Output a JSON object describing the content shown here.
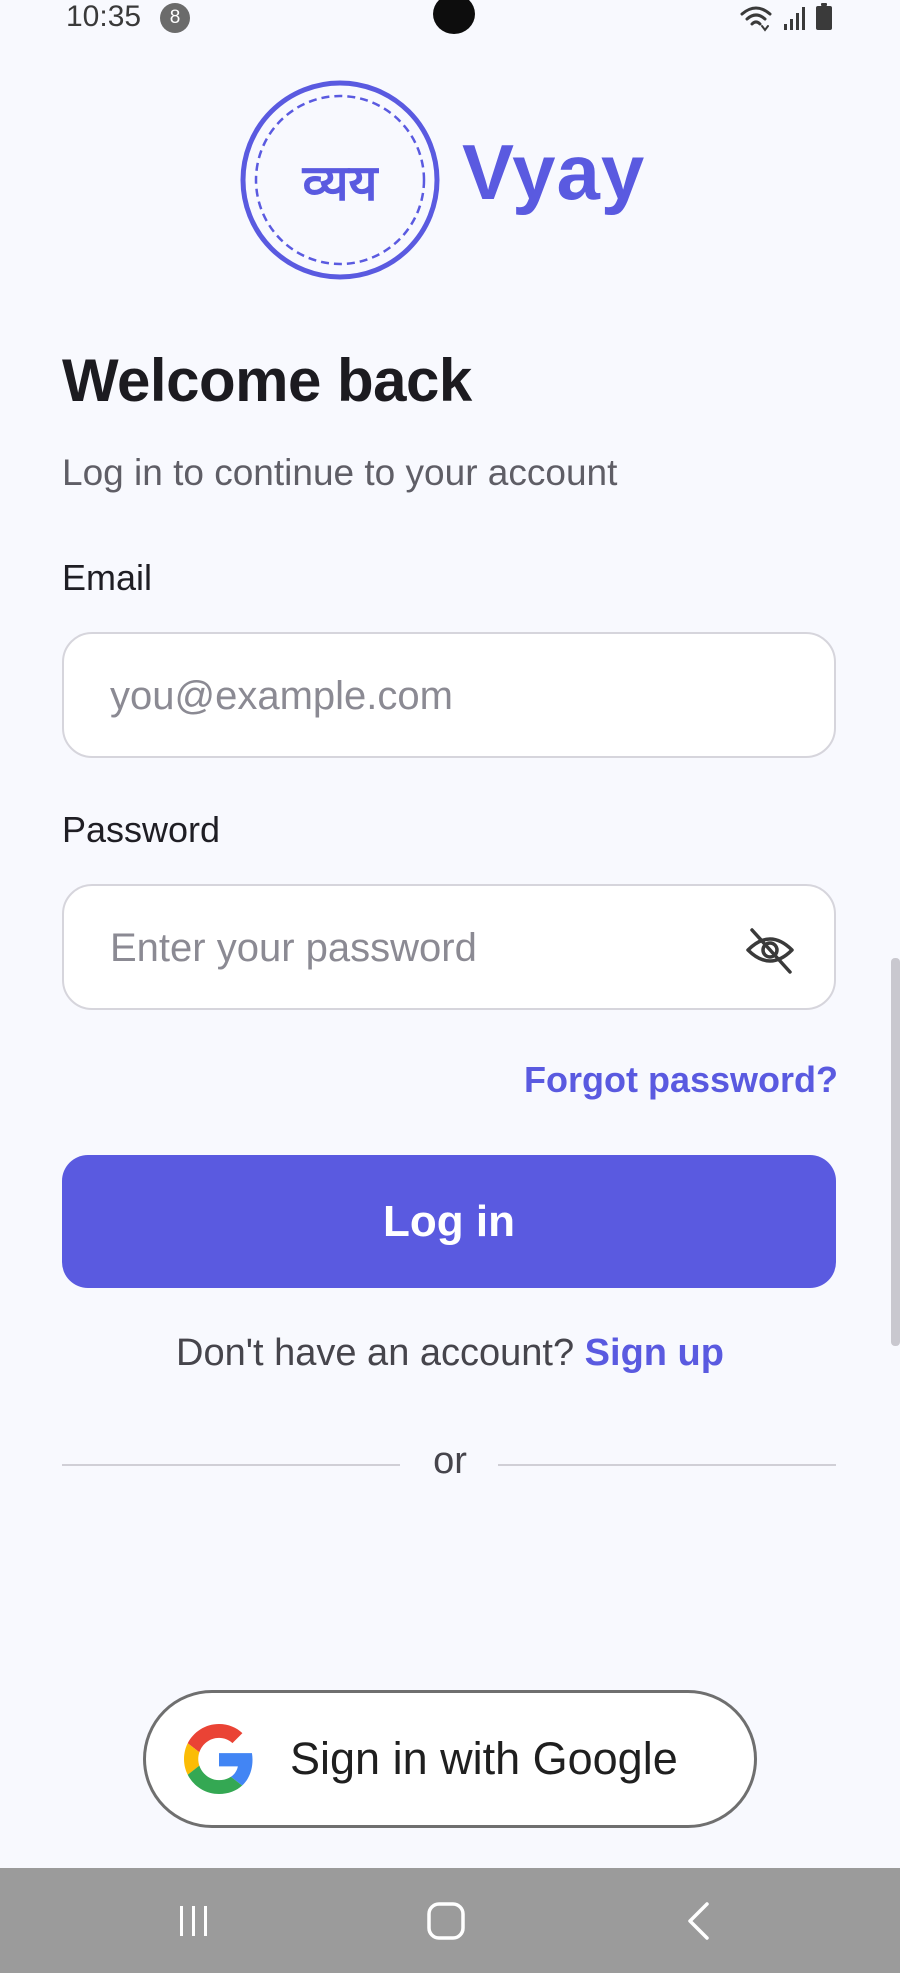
{
  "status_bar": {
    "time": "10:35",
    "notification_count": "8",
    "icons": [
      "wifi-icon",
      "signal-icon",
      "battery-icon"
    ]
  },
  "logo": {
    "emblem_text": "व्यय",
    "wordmark": "Vyay",
    "color": "#5a5ae0"
  },
  "header": {
    "title": "Welcome back",
    "subtitle": "Log in to continue to your account"
  },
  "form": {
    "email": {
      "label": "Email",
      "value": "",
      "placeholder": "you@example.com"
    },
    "password": {
      "label": "Password",
      "value": "",
      "placeholder": "Enter your password",
      "toggle_icon": "eye-off-icon"
    },
    "forgot_link": "Forgot password?",
    "login_button": "Log in",
    "signup_prompt": "Don't have an account?",
    "signup_link": "Sign up",
    "divider_text": "or",
    "google_button": "Sign in with Google"
  },
  "nav_bar": {
    "buttons": [
      "recent-apps-icon",
      "home-icon",
      "back-icon"
    ]
  },
  "colors": {
    "accent": "#5a5ae0",
    "background": "#f8f9fe",
    "nav_bar": "#9b9b9b"
  }
}
